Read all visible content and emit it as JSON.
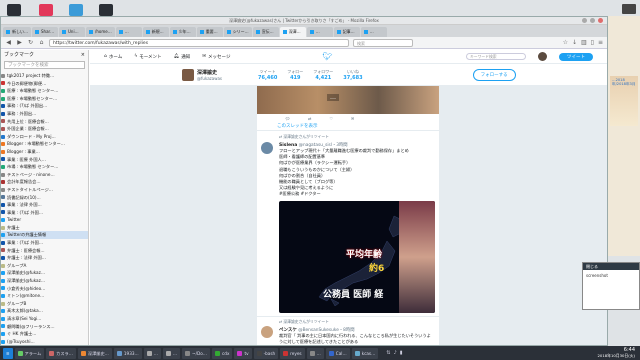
{
  "window": {
    "title": "深澤諭史(@fukazawas)さん | Twitterから引き取りさ「すごめ」 - Mozilla Firefox"
  },
  "tabs": [
    {
      "label": "新しい…",
      "active": false
    },
    {
      "label": "Shar…",
      "active": false
    },
    {
      "label": "Uni…",
      "active": false
    },
    {
      "label": "/home…",
      "active": false
    },
    {
      "label": "…",
      "active": false
    },
    {
      "label": "新規…",
      "active": false
    },
    {
      "label": "少年…",
      "active": false
    },
    {
      "label": "重要…",
      "active": false
    },
    {
      "label": "シリー…",
      "active": false
    },
    {
      "label": "宣伝…",
      "active": false
    },
    {
      "label": "深澤…",
      "active": true
    },
    {
      "label": "…",
      "active": false
    },
    {
      "label": "記事…",
      "active": false
    },
    {
      "label": "…",
      "active": false
    }
  ],
  "navbar": {
    "url": "https://twitter.com/fukazawas/with_replies",
    "search_placeholder": "検索"
  },
  "sidebar": {
    "title": "ブックマーク",
    "search_placeholder": "ブックマークを検索",
    "items": [
      {
        "label": "tgk2017 project 特徴…",
        "color": "#888"
      },
      {
        "label": "今日の郵便物(郵便…",
        "color": "#c33"
      },
      {
        "label": "医療 : 市場動態 センター…",
        "color": "#2a7"
      },
      {
        "label": "医療 : 市場動態センター…",
        "color": "#2a7"
      },
      {
        "label": "事務 : (?)ば 外国出…",
        "color": "#15a"
      },
      {
        "label": "事務 : 外国出…",
        "color": "#15a"
      },
      {
        "label": "共用上位 : 医療会報…",
        "color": "#a55"
      },
      {
        "label": "外国企業 : 医療会報…",
        "color": "#a55"
      },
      {
        "label": "ダウンロード - My Proj…",
        "color": "#27c"
      },
      {
        "label": "Blogger : 市場動態センター…",
        "color": "#e72"
      },
      {
        "label": "Blogger : 事業…",
        "color": "#e72"
      },
      {
        "label": "事業 : 医療 外国人…",
        "color": "#15a"
      },
      {
        "label": "市場 : 市場動態 センター…",
        "color": "#2a7"
      },
      {
        "label": "テストページ - ninone…",
        "color": "#888"
      },
      {
        "label": "会計年度報告会…",
        "color": "#a33"
      },
      {
        "label": "テストタイトルページ…",
        "color": "#888"
      },
      {
        "label": "読書記録の(10)…",
        "color": "#579"
      },
      {
        "label": "事業 : 法律 外国…",
        "color": "#15a"
      },
      {
        "label": "事業 : (?)ば 外国…",
        "color": "#15a"
      },
      {
        "label": "Twitter",
        "color": "#1da1f2"
      },
      {
        "label": "弁護士",
        "color": "#bb8"
      },
      {
        "label": "Twitterの弁護士情報",
        "color": "#1da1f2",
        "selected": true
      },
      {
        "label": "事業 : (?)ば 外国…",
        "color": "#15a"
      },
      {
        "label": "弁護士 : 医療会報…",
        "color": "#a55"
      },
      {
        "label": "弁護士 : 法律 外国…",
        "color": "#15a"
      },
      {
        "label": "グループA",
        "color": "#bb8"
      },
      {
        "label": "深澤諭史(@fukaz…",
        "color": "#1da1f2"
      },
      {
        "label": "深澤諭史(@fukaz…",
        "color": "#1da1f2"
      },
      {
        "label": "小倉秀夫(@hideo…",
        "color": "#1da1f2"
      },
      {
        "label": "ミトン(@mitone…",
        "color": "#1da1f2"
      },
      {
        "label": "グループB",
        "color": "#bb8"
      },
      {
        "label": "髙木太郎(@taka…",
        "color": "#1da1f2"
      },
      {
        "label": "清水章(Sei Yogi…",
        "color": "#1da1f2"
      },
      {
        "label": "顧問職(@フリーランス…",
        "color": "#1da1f2"
      },
      {
        "label": "ぐ HK 弁護士…",
        "color": "#1da1f2"
      },
      {
        "label": "(@Tsuyoshi…",
        "color": "#1da1f2"
      }
    ]
  },
  "twitter": {
    "nav": [
      "ホーム",
      "モーメント",
      "通知",
      "メッセージ"
    ],
    "search_placeholder": "キーワード検索",
    "tweet_button": "ツイート",
    "profile": {
      "name": "深澤諭史",
      "handle": "@fukazawas",
      "stats": [
        {
          "label": "ツイート",
          "value": "76,460"
        },
        {
          "label": "フォロー",
          "value": "419"
        },
        {
          "label": "フォロワー",
          "value": "4,421"
        },
        {
          "label": "いいね",
          "value": "37,683"
        }
      ],
      "follow_button": "フォローする"
    },
    "prev_tweet": {
      "image_caption": "…",
      "more_thread": "このスレッドを表示"
    },
    "tweet": {
      "retweet_line": "深澤諭史さんがリツイート",
      "author": "Sislena",
      "handle": "@nagatasu_sisl",
      "time": "・3時間",
      "body_lines": [
        "フローとアップ現代＋「大量離職進む医療の裁判で勤務保存」まとめ",
        "医師・看護師の配置基準",
        "何ばかが医療業界（ラクシー運転手）",
        "退職もこういうものかについて（主婦）",
        "何ばかの割合（自社員）",
        "機能の職員として（ブログ等）",
        "又は経験や見に考えるように"
      ],
      "hashtags": "#医療公務  #ドクター",
      "media": {
        "caption_1": "平均年齢",
        "caption_2": "約6",
        "caption_3": "公務員  医師  経"
      }
    },
    "tweet2": {
      "retweet_line": "深澤諭史さんがリツイート",
      "author": "ペンスケ",
      "handle": "@BensanSukesuke",
      "time": "・8時間",
      "body": "裁判官「 判事の主に日本国内に行われる、こんなところ私が生じたいそういうように対して医療を記述してきたことがある"
    }
  },
  "right_panel": {
    "snippet": "…2018年/2018年3月"
  },
  "popup": {
    "title": "閉じる",
    "text": "screenshot"
  },
  "taskbar": {
    "items": [
      {
        "label": "アラーム",
        "color": "#6c6"
      },
      {
        "label": "カスラ…",
        "color": "#c66"
      },
      {
        "label": "深澤諭史…",
        "color": "#e83"
      },
      {
        "label": "1933…",
        "color": "#69c"
      },
      {
        "label": "…",
        "color": "#aaa"
      },
      {
        "label": "…",
        "color": "#aaa"
      },
      {
        "label": "~/Do…",
        "color": "#888"
      },
      {
        "label": "cdx",
        "color": "#3a3"
      },
      {
        "label": "tv",
        "color": "#c3c"
      },
      {
        "label": "-bash",
        "color": "#444"
      },
      {
        "label": "reyes",
        "color": "#c33"
      },
      {
        "label": "…",
        "color": "#888"
      },
      {
        "label": "Cal…",
        "color": "#36c"
      },
      {
        "label": "kcas…",
        "color": "#6ac"
      }
    ],
    "time": "6:44",
    "date": "2018年10月30日(火)"
  }
}
